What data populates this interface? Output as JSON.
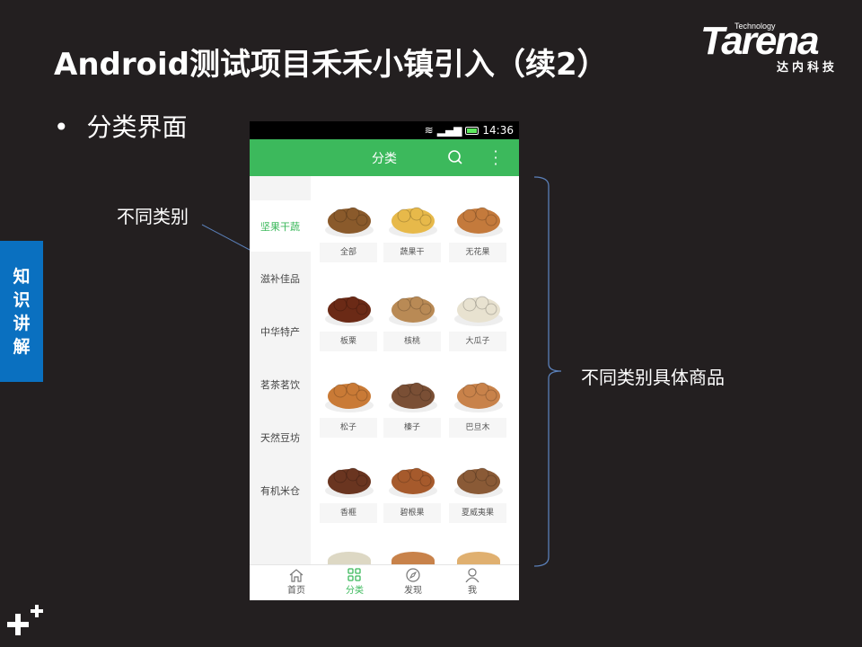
{
  "slide": {
    "title": "Android测试项目禾禾小镇引入（续2）",
    "bullet": "分类界面",
    "section_tab": [
      "知",
      "识",
      "讲",
      "解"
    ],
    "annotation_left": "不同类别",
    "annotation_right": "不同类别具体商品"
  },
  "logo": {
    "tech": "Technology",
    "name": "Tarena",
    "cn": "达内科技"
  },
  "phone": {
    "status": {
      "time": "14:36"
    },
    "header": {
      "title": "分类"
    },
    "categories": [
      {
        "label": "坚果干蔬",
        "selected": true
      },
      {
        "label": "滋补佳品"
      },
      {
        "label": "中华特产"
      },
      {
        "label": "茗茶茗饮"
      },
      {
        "label": "天然豆坊"
      },
      {
        "label": "有机米仓"
      }
    ],
    "products": [
      {
        "label": "全部",
        "color": "#8a5a2b"
      },
      {
        "label": "蔬果干",
        "color": "#e7b94a"
      },
      {
        "label": "无花果",
        "color": "#c47a3c"
      },
      {
        "label": "板栗",
        "color": "#6b2a16"
      },
      {
        "label": "核桃",
        "color": "#b98a55"
      },
      {
        "label": "大瓜子",
        "color": "#e8e2d0"
      },
      {
        "label": "松子",
        "color": "#c97a36"
      },
      {
        "label": "榛子",
        "color": "#7a4f35"
      },
      {
        "label": "巴旦木",
        "color": "#c8824a"
      },
      {
        "label": "香榧",
        "color": "#6a3520"
      },
      {
        "label": "碧根果",
        "color": "#a65a2c"
      },
      {
        "label": "夏威夷果",
        "color": "#8a5a36"
      }
    ],
    "nav": [
      {
        "label": "首页"
      },
      {
        "label": "分类",
        "selected": true
      },
      {
        "label": "发现"
      },
      {
        "label": "我"
      }
    ]
  },
  "colors": {
    "accent": "#3cb95c",
    "tab": "#0a70c0",
    "background": "#231f20"
  }
}
